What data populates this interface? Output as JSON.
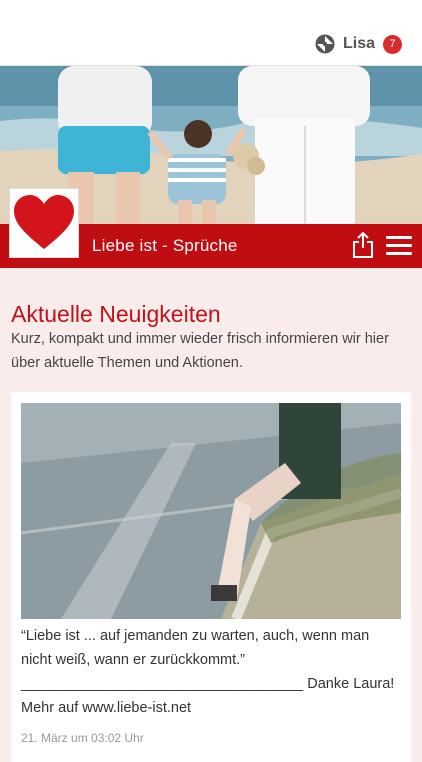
{
  "header": {
    "user_name": "Lisa",
    "notification_count": "7"
  },
  "app": {
    "title": "Liebe ist - Sprüche"
  },
  "main": {
    "section_title": "Aktuelle Neuigkeiten",
    "intro": "Kurz, kompakt und immer wieder frisch informieren wir hier über aktuelle Themen und Aktionen."
  },
  "post": {
    "quote": "“Liebe ist ... auf jemanden zu warten, auch, wenn man nicht weiß, wann er zurückkommt.”",
    "signature": "___________________________________ Danke Laura!",
    "more": "Mehr auf www.liebe-ist.net",
    "timestamp": "21. März um 03:02 Uhr"
  },
  "icons": {
    "user_logo": "puzzle-logo-icon",
    "app_logo": "heart-icon",
    "share": "share-icon",
    "menu": "hamburger-menu-icon"
  },
  "colors": {
    "brand_red": "#c00d12",
    "badge_red": "#d92b2b",
    "page_background": "#fbecec"
  }
}
